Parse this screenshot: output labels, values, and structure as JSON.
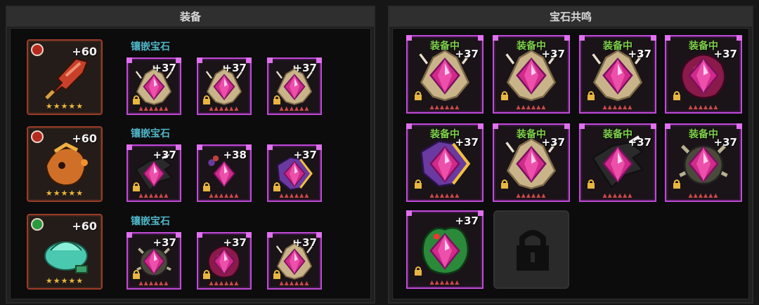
{
  "left_panel": {
    "title": "装备",
    "rows": [
      {
        "equip": {
          "level": "+60",
          "icon": "fire-sword-icon",
          "stars": "★★★★★",
          "badge": "red-element-icon"
        },
        "gem_label": "镶嵌宝石",
        "gems": [
          {
            "level": "+37",
            "icon": "gold-crest-gem-icon"
          },
          {
            "level": "+37",
            "icon": "gold-crest-gem-icon"
          },
          {
            "level": "+37",
            "icon": "gold-crest-gem-icon"
          }
        ]
      },
      {
        "equip": {
          "level": "+60",
          "icon": "fire-beast-icon",
          "stars": "★★★★★",
          "badge": "red-element-icon"
        },
        "gem_label": "镶嵌宝石",
        "gems": [
          {
            "level": "+37",
            "icon": "dark-wing-gem-icon"
          },
          {
            "level": "+38",
            "icon": "cluster-gem-icon"
          },
          {
            "level": "+37",
            "icon": "purple-shield-gem-icon"
          }
        ]
      },
      {
        "equip": {
          "level": "+60",
          "icon": "jade-artifact-icon",
          "stars": "★★★★★",
          "badge": "green-element-icon"
        },
        "gem_label": "镶嵌宝石",
        "gems": [
          {
            "level": "+37",
            "icon": "antler-gem-icon"
          },
          {
            "level": "+37",
            "icon": "crimson-swirl-gem-icon"
          },
          {
            "level": "+37",
            "icon": "gold-crest-gem-icon"
          }
        ]
      }
    ]
  },
  "right_panel": {
    "title": "宝石共鸣",
    "equipped_text": "装备中",
    "gems": [
      {
        "level": "+37",
        "equipped": true,
        "icon": "gold-crest-gem-icon"
      },
      {
        "level": "+37",
        "equipped": true,
        "icon": "gold-crest-gem-icon"
      },
      {
        "level": "+37",
        "equipped": true,
        "icon": "gold-crest-gem-icon"
      },
      {
        "level": "+37",
        "equipped": true,
        "icon": "crimson-swirl-gem-icon"
      },
      {
        "level": "+37",
        "equipped": true,
        "icon": "purple-shield-gem-icon"
      },
      {
        "level": "+37",
        "equipped": true,
        "icon": "gold-crest-gem-icon"
      },
      {
        "level": "+37",
        "equipped": true,
        "icon": "dark-wing-gem-icon"
      },
      {
        "level": "+37",
        "equipped": true,
        "icon": "antler-gem-icon"
      },
      {
        "level": "+37",
        "equipped": false,
        "icon": "green-serpent-gem-icon"
      }
    ],
    "locked_slot_icon": "padlock-icon"
  },
  "colors": {
    "gem_border": "#c04ad8",
    "equipped_text": "#7ed04a",
    "gem_label": "#4fb6c8",
    "star": "#e8b640"
  }
}
